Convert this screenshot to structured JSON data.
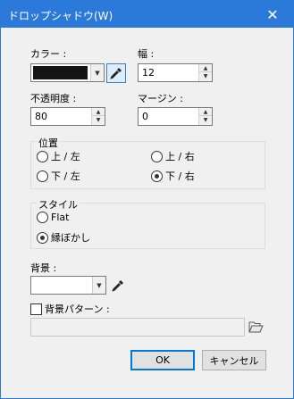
{
  "window": {
    "title": "ドロップシャドウ(W)",
    "close_label": "✕"
  },
  "color": {
    "label": "カラー :",
    "value": "#141414"
  },
  "width": {
    "label": "幅 :",
    "value": "12"
  },
  "opacity": {
    "label": "不透明度 :",
    "value": "80"
  },
  "margin": {
    "label": "マージン :",
    "value": "0"
  },
  "position": {
    "title": "位置",
    "options": [
      {
        "label": "上 / 左",
        "selected": false
      },
      {
        "label": "上 / 右",
        "selected": false
      },
      {
        "label": "下 / 左",
        "selected": false
      },
      {
        "label": "下 / 右",
        "selected": true
      }
    ]
  },
  "style": {
    "title": "スタイル",
    "options": [
      {
        "label": "Flat",
        "selected": false
      },
      {
        "label": "縁ぼかし",
        "selected": true
      }
    ]
  },
  "background": {
    "label": "背景 :",
    "value": "#ffffff"
  },
  "bg_pattern": {
    "label": "背景パターン :",
    "checked": false,
    "value": ""
  },
  "buttons": {
    "ok": "OK",
    "cancel": "キャンセル"
  },
  "colors": {
    "titlebar": "#2b79d8",
    "accent": "#0078d7"
  },
  "icons": {
    "eyedropper": "eyedropper-icon",
    "folder": "folder-open-icon",
    "dropdown": "chevron-down-icon",
    "close": "close-icon"
  }
}
